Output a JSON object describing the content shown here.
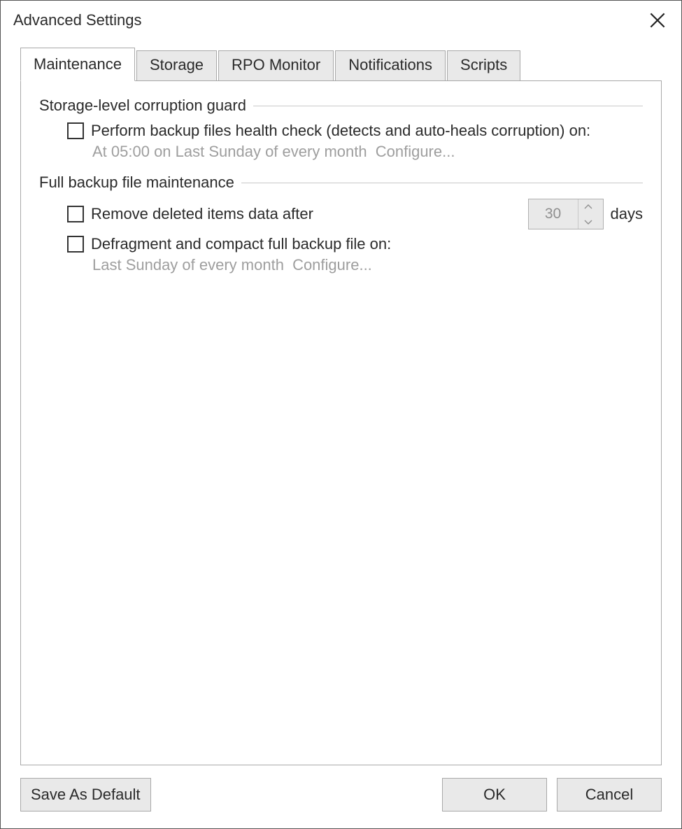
{
  "window": {
    "title": "Advanced Settings"
  },
  "tabs": [
    {
      "label": "Maintenance",
      "active": true
    },
    {
      "label": "Storage",
      "active": false
    },
    {
      "label": "RPO Monitor",
      "active": false
    },
    {
      "label": "Notifications",
      "active": false
    },
    {
      "label": "Scripts",
      "active": false
    }
  ],
  "group1": {
    "title": "Storage-level corruption guard",
    "healthcheck": {
      "checked": false,
      "label": "Perform backup files health check (detects and auto-heals corruption) on:",
      "schedule": "At 05:00 on Last Sunday of every month",
      "configure": "Configure..."
    }
  },
  "group2": {
    "title": "Full backup file maintenance",
    "remove": {
      "checked": false,
      "label": "Remove deleted items data after",
      "value": "30",
      "unit": "days"
    },
    "defrag": {
      "checked": false,
      "label": "Defragment and compact full backup file on:",
      "schedule": "Last Sunday of every month",
      "configure": "Configure..."
    }
  },
  "buttons": {
    "save_default": "Save As Default",
    "ok": "OK",
    "cancel": "Cancel"
  }
}
